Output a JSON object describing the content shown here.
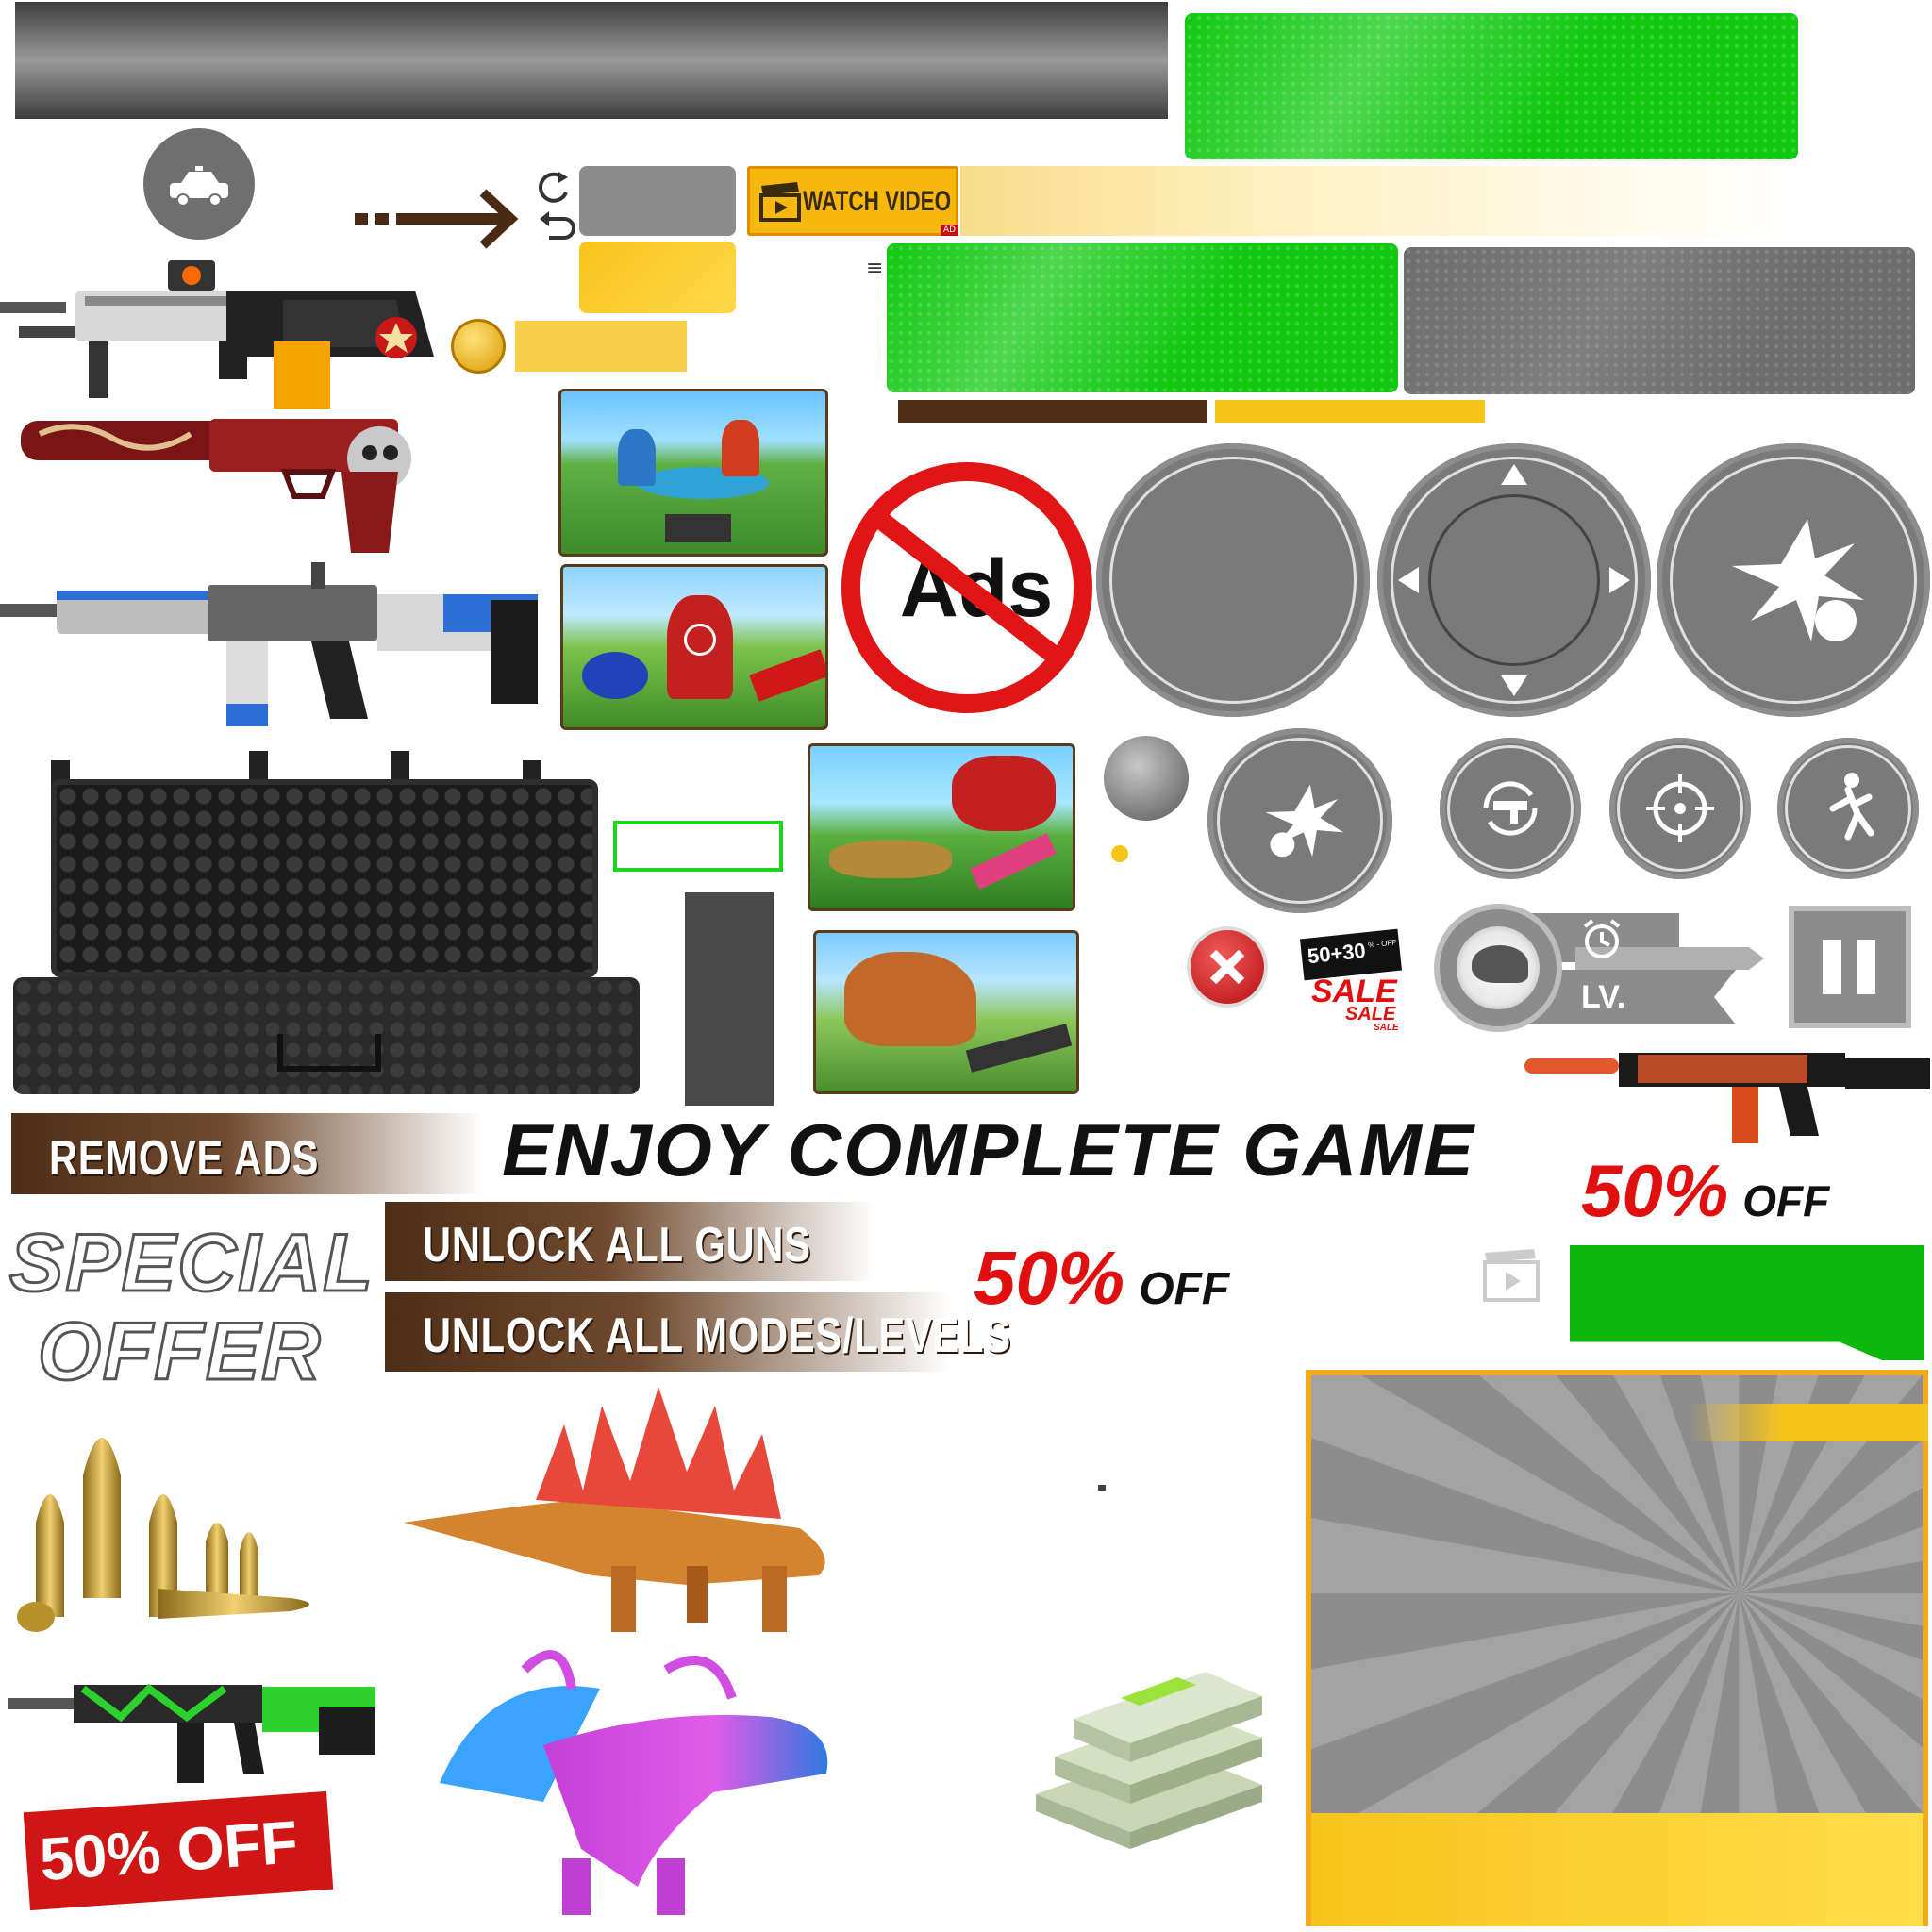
{
  "watch_video": {
    "label": "WATCH VIDEO",
    "ad_badge": "AD"
  },
  "ads_sign": {
    "text": "Ads"
  },
  "sale_sticker": {
    "top": "50+30",
    "pct": "% - OFF",
    "sale": "SALE",
    "sale2": "SALE",
    "sale3": "SALE"
  },
  "level_badge": {
    "label": "LV."
  },
  "banners": {
    "remove_ads": "REMOVE ADS",
    "enjoy": "ENJOY COMPLETE GAME",
    "unlock_guns": "UNLOCK ALL GUNS",
    "unlock_modes": "UNLOCK ALL MODES/LEVELS",
    "special": "SPECIAL",
    "offer": "OFFER"
  },
  "discounts": {
    "center_pct": "50%",
    "center_off": "OFF",
    "right_pct": "50%",
    "right_off": "OFF",
    "stamp": "50% OFF"
  },
  "small_glyph": "≡",
  "icons": [
    "police-car-icon",
    "refresh-icon",
    "undo-icon",
    "coin-icon",
    "clapperboard-icon",
    "explosion-icon",
    "reload-gun-icon",
    "crosshair-icon",
    "jump-icon",
    "close-icon",
    "alarm-clock-icon",
    "pause-icon",
    "video-icon",
    "dpad-up-icon",
    "dpad-down-icon",
    "dpad-left-icon",
    "dpad-right-icon"
  ],
  "colors": {
    "green": "#12c912",
    "yellow": "#f7c41c",
    "grey": "#7a7a7a",
    "brown": "#4d2e16",
    "red": "#e01010"
  }
}
